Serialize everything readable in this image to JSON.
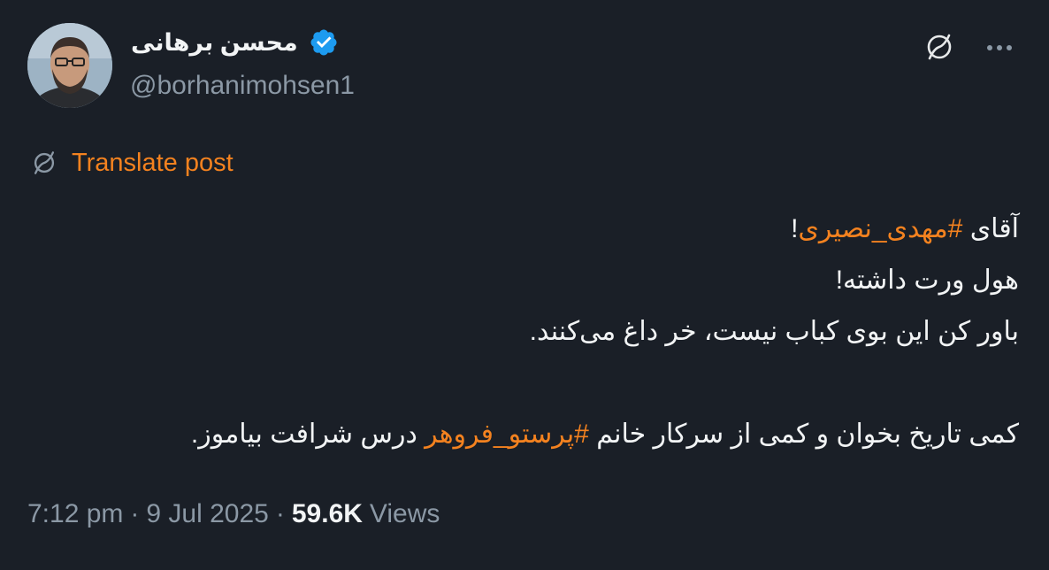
{
  "author": {
    "display_name": "محسن برهانی",
    "handle": "@borhanimohsen1",
    "verified": true
  },
  "header_actions": {
    "translate_icon": "translate-icon",
    "more_icon": "more-horizontal-icon"
  },
  "translate": {
    "icon": "translate-icon",
    "label": "Translate post"
  },
  "tweet": {
    "line1": {
      "text_before": "آقای ",
      "hashtag": "#مهدی_نصیری",
      "text_after": "!"
    },
    "line2": "هول ورت داشته!",
    "line3": "باور کن این بوی کباب نیست، خر داغ می‌کنند.",
    "line4": {
      "text_before": "کمی تاریخ بخوان و کمی از سرکار خانم ",
      "hashtag": "#پرستو_فروهر",
      "text_after": " درس شرافت بیاموز."
    }
  },
  "meta": {
    "time": "7:12 pm",
    "separator": "·",
    "date": "9 Jul 2025",
    "views_count": "59.6K",
    "views_label": "Views"
  },
  "colors": {
    "background": "#1a1f27",
    "accent": "#f4821f",
    "verified": "#1d9bf0",
    "secondary_text": "#8b98a5",
    "primary_text": "#f2f4f5"
  }
}
